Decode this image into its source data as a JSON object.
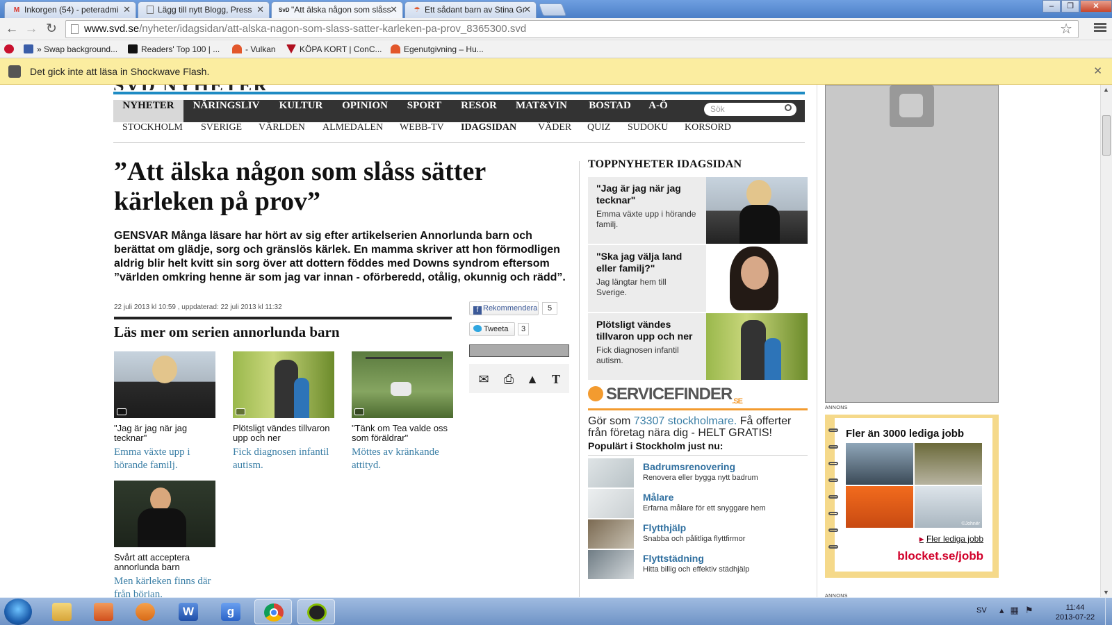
{
  "browser": {
    "tabs": [
      {
        "title": "Inkorgen (54) - peteradmi",
        "icon": "gmail-icon",
        "color": "#d93025"
      },
      {
        "title": "Lägg till nytt Blogg, Press",
        "icon": "page-icon",
        "color": "#777777"
      },
      {
        "title": "\"Att älska någon som slåss",
        "icon": "svd-icon",
        "color": "#111111",
        "active": true,
        "icon_text": "SvD"
      },
      {
        "title": "Ett sådant barn av Stina Gr",
        "icon": "blog-icon",
        "color": "#e2572b"
      }
    ],
    "url_domain": "www.svd.se",
    "url_path": "/nyheter/idagsidan/att-alska-nagon-som-slass-satter-karleken-pa-prov_8365300.svd",
    "bookmarks": [
      {
        "label": "» Swap background...",
        "icon": "swap-icon"
      },
      {
        "label": "Readers' Top 100 | ...",
        "icon": "bm-icon"
      },
      {
        "label": "- Vulkan",
        "icon": "vulkan-icon"
      },
      {
        "label": "KÖPA KORT | ConC...",
        "icon": "kort-icon"
      },
      {
        "label": "Egenutgivning – Hu...",
        "icon": "egen-icon"
      }
    ],
    "infobar_message": "Det gick inte att läsa in Shockwave Flash."
  },
  "site": {
    "logo_fragment": "SVD NYHETER",
    "main_nav": [
      "NYHETER",
      "NÄRINGSLIV",
      "KULTUR",
      "OPINION",
      "SPORT",
      "RESOR",
      "MAT&VIN",
      "BOSTAD",
      "A-Ö"
    ],
    "main_nav_active": "NYHETER",
    "search_placeholder": "Sök",
    "sub_nav": [
      "STOCKHOLM",
      "SVERIGE",
      "VÄRLDEN",
      "ALMEDALEN",
      "WEBB-TV",
      "IDAGSIDAN",
      "VÄDER",
      "QUIZ",
      "SUDOKU",
      "KORSORD"
    ],
    "sub_nav_active": "IDAGSIDAN",
    "brand_blue": "#1e8bc3"
  },
  "article": {
    "headline": "”Att älska någon som slåss sätter kärleken på prov”",
    "lead": "GENSVAR Många läsare har hört av sig efter artikelserien Annorlunda barn och berättat om glädje, sorg och gränslös kärlek. En mamma skriver att hon förmodligen aldrig blir helt kvitt sin sorg över att dottern föddes med Downs syndrom eftersom ”världen omkring henne är som jag var innan - oförberedd, otålig, okunnig och rädd”.",
    "dateline": "22 juli 2013 kl 10:59 , uppdaterad: 22 juli 2013 kl 11:32",
    "readmore_title": "Läs mer om serien annorlunda barn",
    "related": [
      {
        "title": "\"Jag är jag när jag tecknar\"",
        "link": "Emma växte upp i hörande familj."
      },
      {
        "title": "Plötsligt vändes tillvaron upp och ner",
        "link": "Fick diagnosen infantil autism."
      },
      {
        "title": "\"Tänk om Tea valde oss som föräldrar\"",
        "link": "Möttes av kränkande attityd."
      },
      {
        "title": "Svårt att acceptera annorlunda barn",
        "link": "Men kärleken finns där från början."
      }
    ],
    "share": {
      "facebook_label": "Rekommendera",
      "facebook_count": "5",
      "twitter_label": "Tweeta",
      "twitter_count": "3"
    }
  },
  "top_news": {
    "title": "TOPPNYHETER IDAGSIDAN",
    "items": [
      {
        "headline": "\"Jag är jag när jag tecknar\"",
        "summary": "Emma växte upp i hörande familj."
      },
      {
        "headline": "\"Ska jag välja land eller familj?\"",
        "summary": "Jag längtar hem till Sverige."
      },
      {
        "headline": "Plötsligt vändes tillvaron upp och ner",
        "summary": "Fick diagnosen infantil autism."
      }
    ]
  },
  "servicefinder": {
    "logo": "SERVICEFINDER",
    "logo_suffix": ".SE",
    "text_before": "Gör som ",
    "text_link": "73307 stockholmare.",
    "text_after": " Få offerter från företag nära dig - HELT GRATIS!",
    "popular_title": "Populärt i Stockholm just nu:",
    "items": [
      {
        "title": "Badrumsrenovering",
        "desc": "Renovera eller bygga nytt badrum"
      },
      {
        "title": "Målare",
        "desc": "Erfarna målare för ett snyggare hem"
      },
      {
        "title": "Flytthjälp",
        "desc": "Snabba och pålitliga flyttfirmor"
      },
      {
        "title": "Flyttstädning",
        "desc": "Hitta billig och effektiv städhjälp"
      }
    ],
    "accent": "#f39b2f"
  },
  "ads": {
    "annons_label": "ANNONS",
    "blocket_title": "Fler än 3000 lediga jobb",
    "blocket_link": "Fler lediga jobb",
    "blocket_logo": "blocket.se/jobb",
    "photo_credit": "©Johnér"
  },
  "taskbar": {
    "language": "SV",
    "time": "11:44",
    "date": "2013-07-22",
    "apps": [
      {
        "name": "explorer-icon",
        "label": ""
      },
      {
        "name": "paint-icon",
        "label": ""
      },
      {
        "name": "media-player-icon",
        "label": ""
      },
      {
        "name": "word-icon",
        "label": "W"
      },
      {
        "name": "google-icon",
        "label": "g"
      },
      {
        "name": "chrome-icon",
        "label": ""
      },
      {
        "name": "spotify-icon",
        "label": ""
      }
    ]
  }
}
